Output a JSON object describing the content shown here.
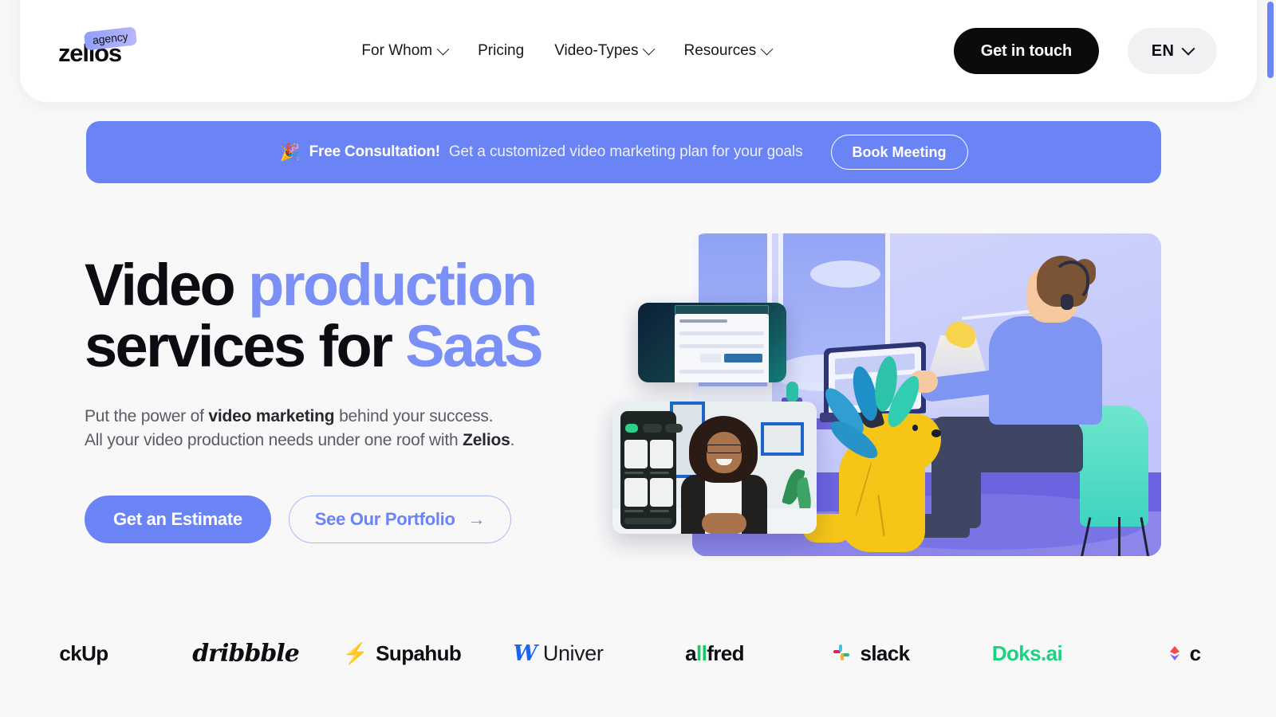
{
  "header": {
    "logo": {
      "word": "zelios",
      "badge": "agency"
    },
    "nav": [
      {
        "label": "For Whom",
        "has_dropdown": true
      },
      {
        "label": "Pricing",
        "has_dropdown": false
      },
      {
        "label": "Video-Types",
        "has_dropdown": true
      },
      {
        "label": "Resources",
        "has_dropdown": true
      }
    ],
    "cta_label": "Get in touch",
    "language": "EN"
  },
  "banner": {
    "emoji": "🎉",
    "strong": "Free Consultation!",
    "text": "Get a customized video marketing plan for your goals",
    "button_label": "Book Meeting"
  },
  "hero": {
    "headline": {
      "part1": "Video ",
      "accent1": "production",
      "part2": "services for ",
      "accent2": "SaaS"
    },
    "sub_line1_a": "Put the power of ",
    "sub_line1_b": "video marketing",
    "sub_line1_c": " behind your success.",
    "sub_line2_a": "All your video production needs under one roof with ",
    "sub_line2_b": "Zelios",
    "sub_line2_c": ".",
    "cta_primary": "Get an Estimate",
    "cta_secondary": "See Our Portfolio",
    "cta_secondary_icon": "→"
  },
  "logos": [
    {
      "name": "ckUp",
      "style": "bold"
    },
    {
      "name": "dribbble",
      "style": "script"
    },
    {
      "name": "Supahub",
      "style": "bolt"
    },
    {
      "name": "Univer",
      "style": "univer"
    },
    {
      "name": "allfred",
      "style": "allfred"
    },
    {
      "name": "slack",
      "style": "slack"
    },
    {
      "name": "Doks.ai",
      "style": "green"
    },
    {
      "name": "c",
      "style": "cmark"
    }
  ],
  "colors": {
    "accent_blue": "#6b84f5",
    "headline_accent": "#7b90f7",
    "dark": "#0b0b0e",
    "page_bg": "#f8f8f9"
  }
}
